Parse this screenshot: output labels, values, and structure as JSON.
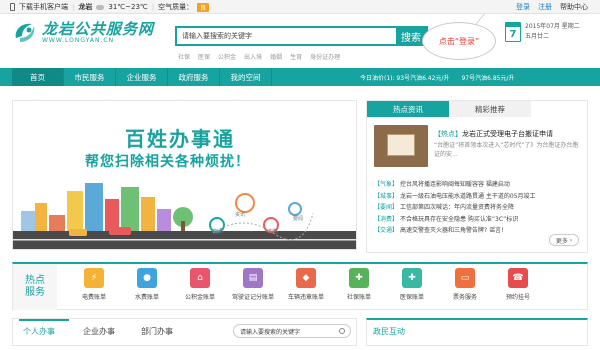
{
  "topbar": {
    "download": "下载手机客户端",
    "city": "龙岩",
    "temperature": "31℃~23℃",
    "air_label": "空气质量：",
    "aqi": "良",
    "login": "登录",
    "register": "注册",
    "help": "帮助中心"
  },
  "logo": {
    "name": "龙岩公共服务网",
    "url": "WWW.LONGYAN.CN"
  },
  "search": {
    "placeholder": "请输入要搜索的关键字",
    "button": "搜索",
    "hotlinks": [
      "社保",
      "医保",
      "公积金",
      "出入境",
      "婚姻",
      "生育",
      "身份证办理"
    ]
  },
  "callout": "点击“登录”",
  "date": {
    "day": "7",
    "line1": "2015年07月 星期二",
    "line2": "五月廿二"
  },
  "nav": {
    "items": [
      "首页",
      "市民服务",
      "企业服务",
      "政府服务",
      "我的空间"
    ],
    "stats": [
      "今日油价(1): 93号汽油6.42元/升",
      "97号汽油6.85元/升"
    ]
  },
  "banner": {
    "title": "百姓办事通",
    "subtitle": "帮您扫除相关各种烦扰！",
    "pins": [
      "资讯",
      "指南",
      "攻略",
      "要闻"
    ]
  },
  "news": {
    "tabs": [
      "热点资讯",
      "精彩推荐"
    ],
    "feature_tag": "【热点】",
    "feature_title": "龙岩正式受理电子台搬证申请",
    "feature_desc": "“台胞证”将首领本次进入“芯时代”了》为台胞证办台胞证的安...",
    "items": [
      {
        "tag": "【气象】",
        "text": "控台风将播连影响闽每知暖容容 福建启动"
      },
      {
        "tag": "【城事】",
        "text": "龙岩一级石油电压能水道路贯通 主干道的05月竣工"
      },
      {
        "tag": "【要闻】",
        "text": "工信部第四次喊话：年内流量资费将务全降"
      },
      {
        "tag": "【消费】",
        "text": "不合格玩具存在安全隐患 购买认准“3C”标识"
      },
      {
        "tag": "【交通】",
        "text": "高速交警查灭火器和三角警告牌? 谣言!"
      }
    ],
    "more": "更多"
  },
  "services": {
    "label_top": "热点",
    "label_bottom": "服务",
    "items": [
      {
        "label": "电费账单",
        "icon": "lightning-icon",
        "color": "#f5b335",
        "glyph": "⚡"
      },
      {
        "label": "水费账单",
        "icon": "water-drop-icon",
        "color": "#3fa3dd",
        "glyph": "●"
      },
      {
        "label": "公积金账单",
        "icon": "house-icon",
        "color": "#e8556c",
        "glyph": "⌂"
      },
      {
        "label": "驾驶证记分账单",
        "icon": "license-card-icon",
        "color": "#9e77c7",
        "glyph": "▤"
      },
      {
        "label": "车辆违章账单",
        "icon": "car-icon",
        "color": "#e86a4a",
        "glyph": "◆"
      },
      {
        "label": "社保账单",
        "icon": "social-security-icon",
        "color": "#58b15b",
        "glyph": "✚"
      },
      {
        "label": "医保账单",
        "icon": "medical-cross-icon",
        "color": "#39b8a3",
        "glyph": "✚"
      },
      {
        "label": "票务服务",
        "icon": "ticket-icon",
        "color": "#ef6f3d",
        "glyph": "▭"
      },
      {
        "label": "预约挂号",
        "icon": "appointment-icon",
        "color": "#e64c4c",
        "glyph": "☎"
      }
    ]
  },
  "bottom": {
    "tabs": [
      "个人办事",
      "企业办事",
      "部门办事"
    ],
    "search_placeholder": "请输入要搜索的关键字",
    "gov_title": "政民互动"
  },
  "colors": {
    "accent": "#17a3a0",
    "callout_text": "#e8372e",
    "aqi_badge": "#f2a323"
  }
}
